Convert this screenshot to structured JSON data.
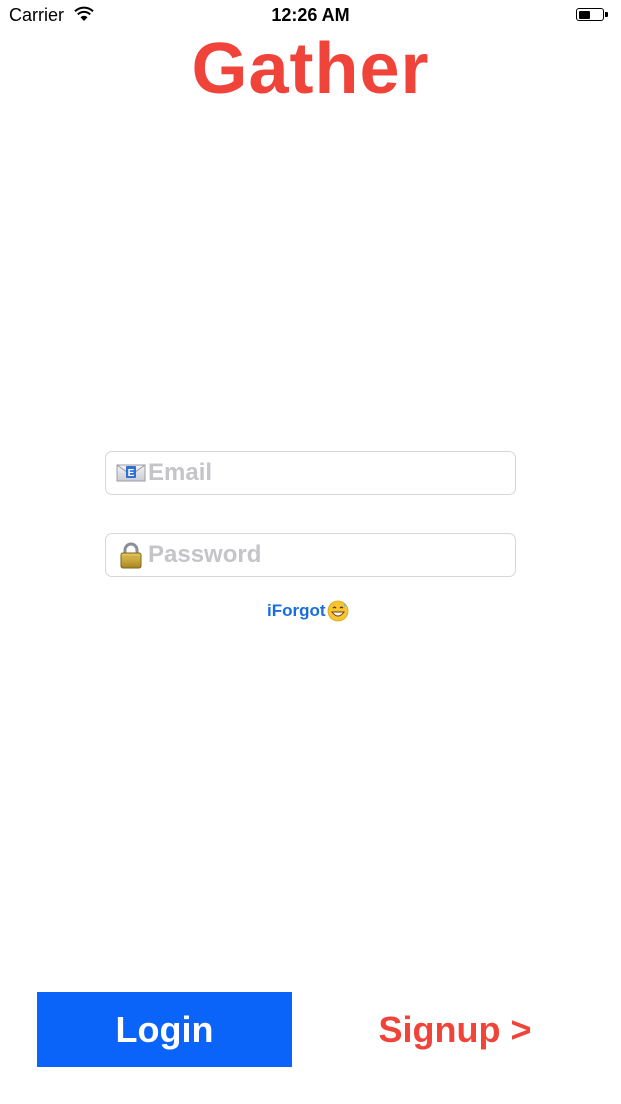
{
  "status_bar": {
    "carrier": "Carrier",
    "time": "12:26 AM",
    "battery_level": 0.5
  },
  "app": {
    "title": "Gather",
    "brand_color": "#f0443a",
    "accent_color": "#0b64fa",
    "link_color": "#1a6edb"
  },
  "login_form": {
    "email": {
      "placeholder": "Email",
      "value": "",
      "icon": "envelope-icon"
    },
    "password": {
      "placeholder": "Password",
      "value": "",
      "icon": "lock-icon"
    },
    "forgot_label": "iForgot",
    "forgot_icon": "grinning-sweat-emoji-icon"
  },
  "actions": {
    "login_label": "Login",
    "signup_label": "Signup >"
  }
}
